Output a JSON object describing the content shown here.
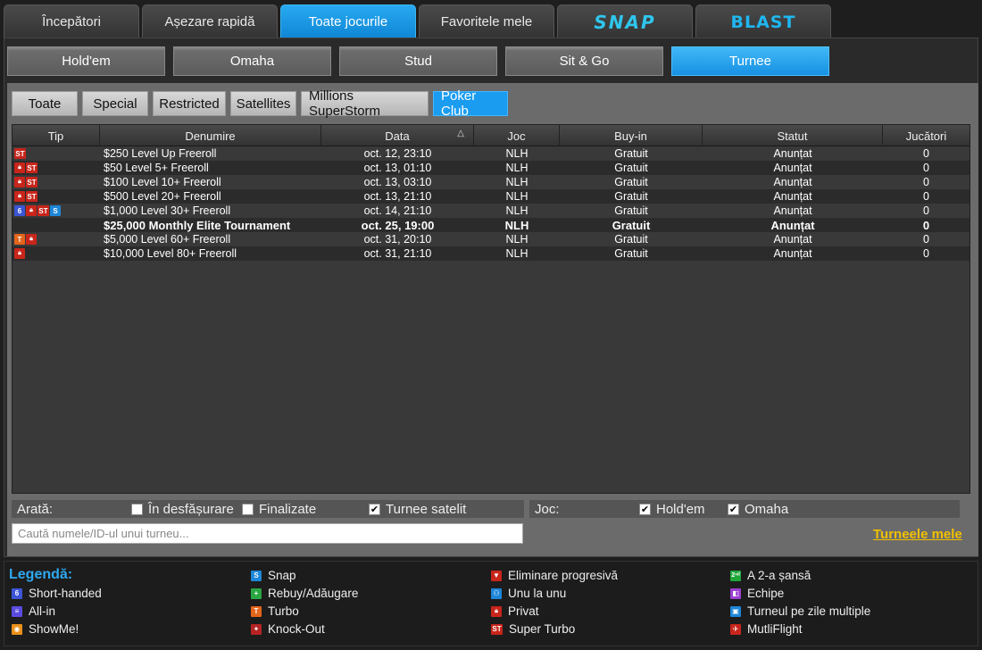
{
  "top_tabs": [
    {
      "label": "Începători",
      "active": false
    },
    {
      "label": "Așezare rapidă",
      "active": false
    },
    {
      "label": "Toate jocurile",
      "active": true
    },
    {
      "label": "Favoritele mele",
      "active": false
    },
    {
      "label": "SNAP",
      "active": false
    },
    {
      "label": "BLAST",
      "active": false
    }
  ],
  "game_tabs": [
    {
      "label": "Hold'em",
      "active": false
    },
    {
      "label": "Omaha",
      "active": false
    },
    {
      "label": "Stud",
      "active": false
    },
    {
      "label": "Sit & Go",
      "active": false
    },
    {
      "label": "Turnee",
      "active": true
    }
  ],
  "sub_tabs": [
    {
      "label": "Toate",
      "active": false
    },
    {
      "label": "Special",
      "active": false
    },
    {
      "label": "Restricted",
      "active": false
    },
    {
      "label": "Satellites",
      "active": false
    },
    {
      "label": "Millions SuperStorm",
      "active": false
    },
    {
      "label": "Poker Club",
      "active": true
    }
  ],
  "table": {
    "columns": [
      "Tip",
      "Denumire",
      "Data",
      "Joc",
      "Buy-in",
      "Statut",
      "Jucători"
    ],
    "sort_indicator": "△",
    "rows": [
      {
        "icons": [
          "ST"
        ],
        "name": "$250 Level Up Freeroll",
        "date": "oct. 12, 23:10",
        "game": "NLH",
        "buyin": "Gratuit",
        "status": "Anunțat",
        "players": "0",
        "bold": false
      },
      {
        "icons": [
          "lock",
          "ST"
        ],
        "name": "$50 Level 5+ Freeroll",
        "date": "oct. 13, 01:10",
        "game": "NLH",
        "buyin": "Gratuit",
        "status": "Anunțat",
        "players": "0",
        "bold": false
      },
      {
        "icons": [
          "lock",
          "ST"
        ],
        "name": "$100 Level 10+ Freeroll",
        "date": "oct. 13, 03:10",
        "game": "NLH",
        "buyin": "Gratuit",
        "status": "Anunțat",
        "players": "0",
        "bold": false
      },
      {
        "icons": [
          "lock",
          "ST"
        ],
        "name": "$500 Level 20+ Freeroll",
        "date": "oct. 13, 21:10",
        "game": "NLH",
        "buyin": "Gratuit",
        "status": "Anunțat",
        "players": "0",
        "bold": false
      },
      {
        "icons": [
          "6",
          "lock",
          "ST",
          "S"
        ],
        "name": "$1,000 Level 30+ Freeroll",
        "date": "oct. 14, 21:10",
        "game": "NLH",
        "buyin": "Gratuit",
        "status": "Anunțat",
        "players": "0",
        "bold": false
      },
      {
        "icons": [],
        "name": "$25,000 Monthly Elite Tournament",
        "date": "oct. 25, 19:00",
        "game": "NLH",
        "buyin": "Gratuit",
        "status": "Anunțat",
        "players": "0",
        "bold": true
      },
      {
        "icons": [
          "T",
          "lock"
        ],
        "name": "$5,000 Level 60+ Freeroll",
        "date": "oct. 31, 20:10",
        "game": "NLH",
        "buyin": "Gratuit",
        "status": "Anunțat",
        "players": "0",
        "bold": false
      },
      {
        "icons": [
          "lock"
        ],
        "name": "$10,000 Level 80+ Freeroll",
        "date": "oct. 31, 21:10",
        "game": "NLH",
        "buyin": "Gratuit",
        "status": "Anunțat",
        "players": "0",
        "bold": false
      }
    ]
  },
  "filters": {
    "show_label": "Arată:",
    "in_progress": {
      "label": "În desfășurare",
      "checked": false
    },
    "finished": {
      "label": "Finalizate",
      "checked": false
    },
    "satellites": {
      "label": "Turnee satelit",
      "checked": true
    },
    "game_label": "Joc:",
    "holdem": {
      "label": "Hold'em",
      "checked": true
    },
    "omaha": {
      "label": "Omaha",
      "checked": true
    }
  },
  "search": {
    "placeholder": "Caută numele/ID-ul unui turneu...",
    "value": ""
  },
  "my_tournaments_label": "Turneele mele",
  "legend": {
    "title": "Legendă:",
    "items": [
      {
        "icon": "6",
        "label": "Short-handed"
      },
      {
        "icon": "allin",
        "label": "All-in"
      },
      {
        "icon": "show",
        "label": "ShowMe!"
      },
      {
        "icon": "S",
        "label": "Snap"
      },
      {
        "icon": "plus",
        "label": "Rebuy/Adăugare"
      },
      {
        "icon": "T",
        "label": "Turbo"
      },
      {
        "icon": "ko",
        "label": "Knock-Out"
      },
      {
        "icon": "elim",
        "label": "Eliminare progresivă"
      },
      {
        "icon": "hu",
        "label": "Unu la unu"
      },
      {
        "icon": "lock",
        "label": "Privat"
      },
      {
        "icon": "ST",
        "label": "Super Turbo"
      },
      {
        "icon": "2nd",
        "label": "A 2-a șansă"
      },
      {
        "icon": "team",
        "label": "Echipe"
      },
      {
        "icon": "multi",
        "label": "Turneul pe zile multiple"
      },
      {
        "icon": "flight",
        "label": "MutliFlight"
      }
    ]
  },
  "colors": {
    "accent": "#1a9cf0",
    "my_tournaments": "#f0c000",
    "legend_title": "#2fa8f0"
  }
}
